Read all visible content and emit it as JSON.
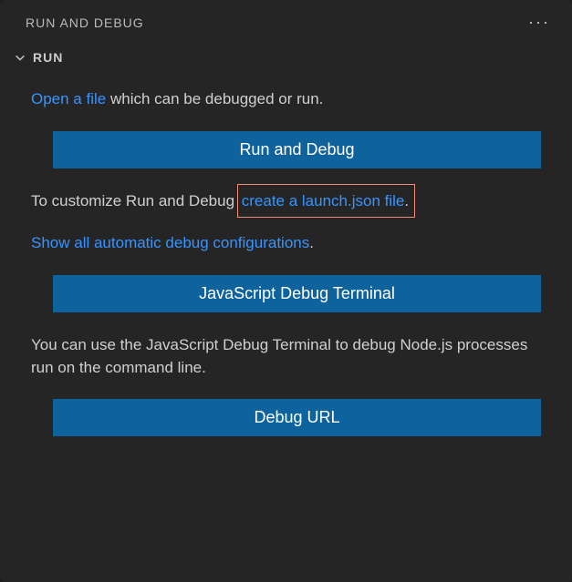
{
  "header": {
    "title": "RUN AND DEBUG"
  },
  "section": {
    "title": "RUN"
  },
  "content": {
    "line1_link": "Open a file",
    "line1_rest": " which can be debugged or run.",
    "btn_run_debug": "Run and Debug",
    "line2_pre": "To customize Run and Debug ",
    "line2_link": "create a launch.json file",
    "line2_post": ".",
    "line3_link": "Show all automatic debug configurations",
    "line3_post": ".",
    "btn_js_terminal": "JavaScript Debug Terminal",
    "line4": "You can use the JavaScript Debug Terminal to debug Node.js processes run on the command line.",
    "btn_debug_url": "Debug URL"
  }
}
